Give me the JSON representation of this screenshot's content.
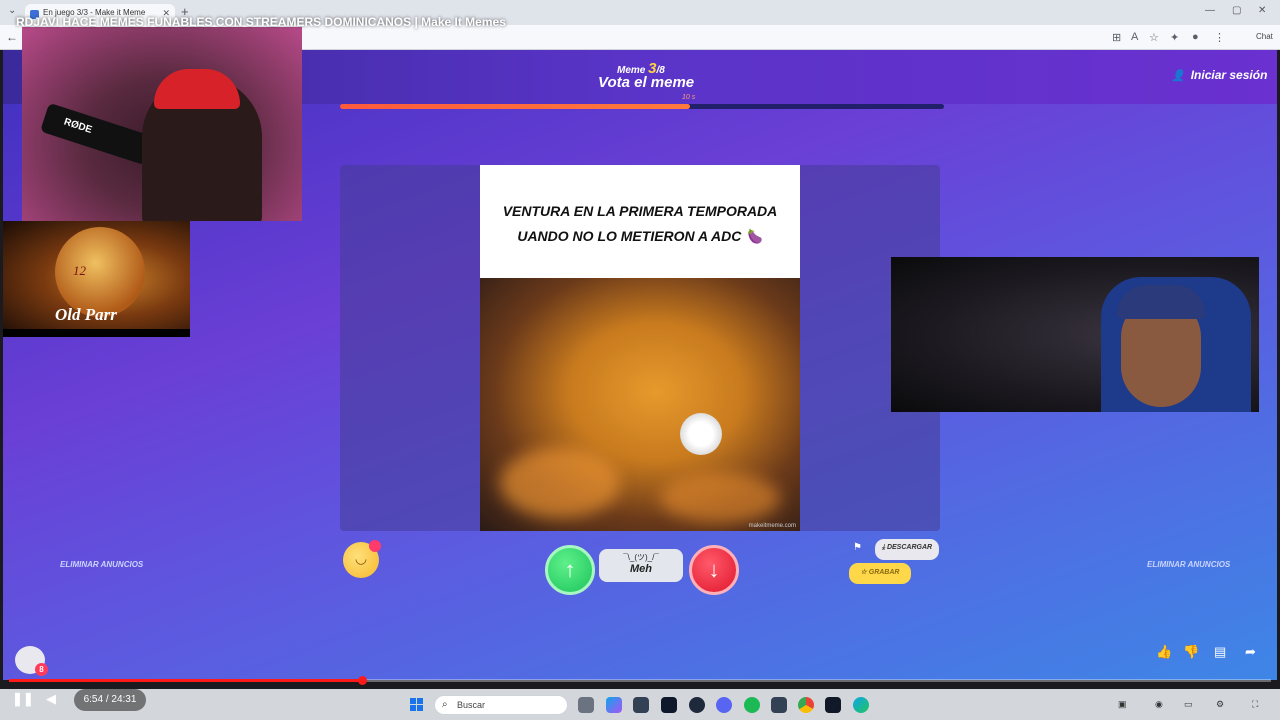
{
  "browser": {
    "tab_title": "En juego 3/3 - Make it Meme",
    "chat_label": "Chat"
  },
  "video": {
    "title": "RDJAVI HACE MEMES FUNABLES CON STREAMERS DOMINICANOS | Make It Memes",
    "time": "6:54 / 24:31",
    "progress": 0.28
  },
  "game": {
    "meme_label": "Meme",
    "meme_current": "3",
    "meme_total": "/8",
    "vote_title": "Vota el meme",
    "timer": "10 s",
    "round_progress": 0.58,
    "login_label": "Iniciar sesión",
    "caption": "VENTURA EN LA PRIMERA TEMPORADA UANDO NO LO METIERON A ADC 🍆",
    "watermark": "makeitmeme.com",
    "meh_shrug": "¯\\_(ツ)_/¯",
    "meh_label": "Meh",
    "download_label": "DESCARGAR",
    "record_label": "GRABAR",
    "remove_ads_left": "ELIMINAR ANUNCIOS",
    "remove_ads_right": "ELIMINAR ANUNCIOS",
    "chat_badge": "8"
  },
  "overlay": {
    "mic_brand": "RØDE",
    "ad_brand": "Old Parr",
    "ad_age": "12"
  },
  "taskbar": {
    "search_placeholder": "Buscar"
  },
  "colors": {
    "up_vote": "#1cc45c",
    "down_vote": "#e0162d",
    "accent_yellow": "#ffd23f",
    "timeline_red": "#ff1a1a"
  }
}
